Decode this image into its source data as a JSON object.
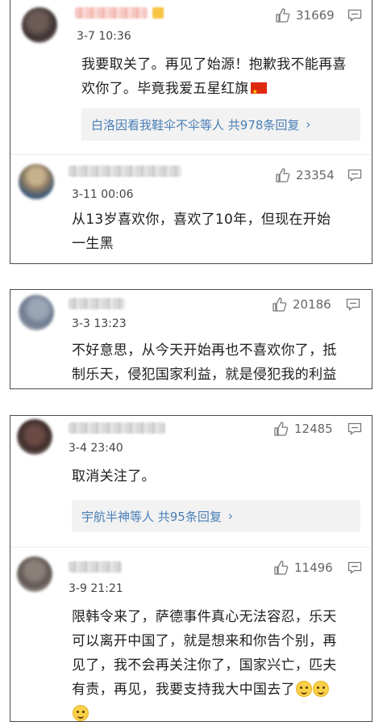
{
  "cards": [
    {
      "comments": [
        {
          "time": "3-7 10:36",
          "likes": "31669",
          "text_lines": [
            "我要取关了。再见了始源！抱歉我不能再喜",
            "欢你了。毕竟我爱五星红旗"
          ],
          "reply_summary": "白洛因看我鞋伞不伞等人 共978条回复",
          "reply_chevron": "›"
        },
        {
          "time": "3-11 00:06",
          "likes": "23354",
          "text_lines": [
            "从13岁喜欢你，喜欢了10年，但现在开始",
            "一生黑"
          ]
        }
      ]
    },
    {
      "comments": [
        {
          "time": "3-3 13:23",
          "likes": "20186",
          "text_lines": [
            "不好意思，从今天开始再也不喜欢你了，抵",
            "制乐天，侵犯国家利益，就是侵犯我的利益"
          ]
        }
      ]
    },
    {
      "comments": [
        {
          "time": "3-4 23:40",
          "likes": "12485",
          "text_lines": [
            "取消关注了。"
          ],
          "reply_summary": "宇航半神等人 共95条回复",
          "reply_chevron": "›"
        },
        {
          "time": "3-9 21:21",
          "likes": "11496",
          "text_lines": [
            "限韩令来了，萨德事件真心无法容忍，乐天",
            "可以离开中国了，就是想来和你告个别，再",
            "见了，我不会再关注你了，国家兴亡，匹夫",
            "有责，再见，我要支持我大中国去了"
          ]
        }
      ]
    }
  ]
}
